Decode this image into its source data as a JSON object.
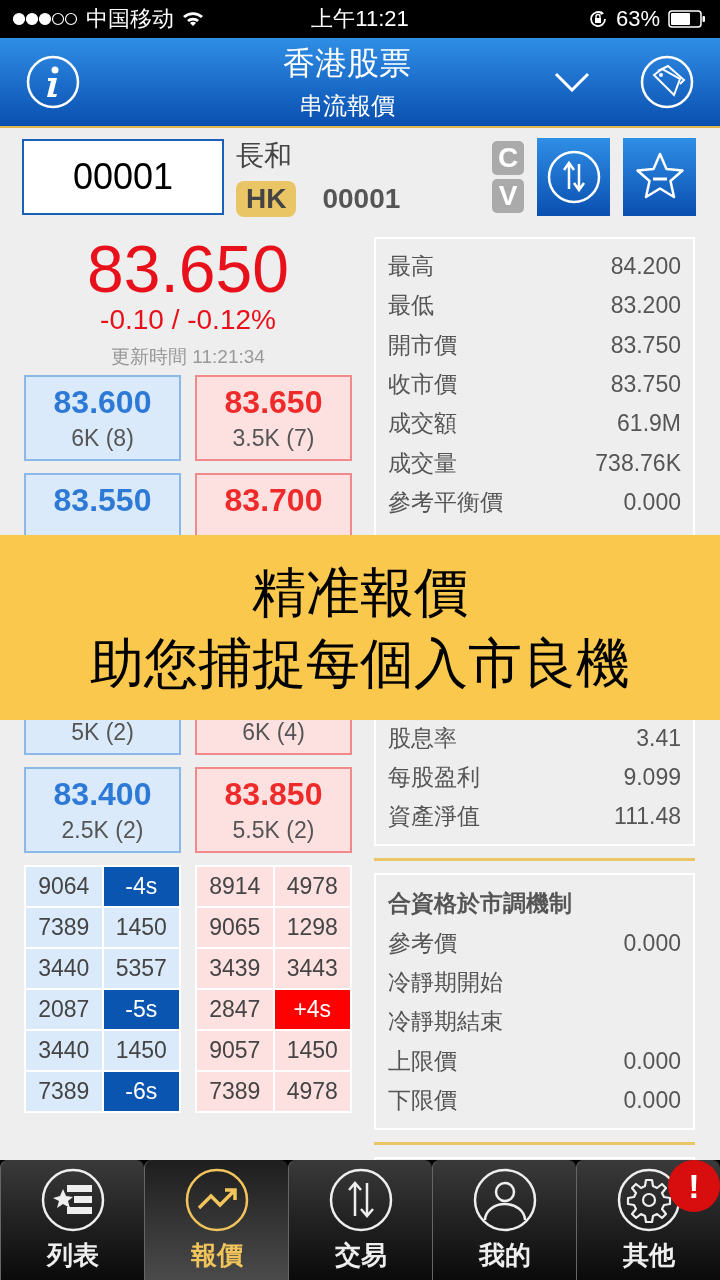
{
  "status_bar": {
    "carrier": "中国移动",
    "time": "上午11:21",
    "battery": "63%"
  },
  "header": {
    "title": "香港股票",
    "subtitle": "串流報價"
  },
  "stock": {
    "code_input": "00001",
    "name": "長和",
    "market": "HK",
    "code": "00001",
    "badges": [
      "C",
      "V"
    ]
  },
  "quote": {
    "price": "83.650",
    "change": "-0.10 / -0.12%",
    "updated": "更新時間 11:21:34"
  },
  "bids": [
    {
      "price": "83.600",
      "volume": "6K (8)"
    },
    {
      "price": "83.550"
    }
  ],
  "bids_below_banner": [
    {
      "volume": "5K (2)"
    },
    {
      "price": "83.400",
      "volume": "2.5K (2)"
    }
  ],
  "asks": [
    {
      "price": "83.650",
      "volume": "3.5K (7)"
    },
    {
      "price": "83.700"
    }
  ],
  "asks_below_banner": [
    {
      "volume": "6K (4)"
    },
    {
      "price": "83.850",
      "volume": "5.5K (2)"
    }
  ],
  "bid_ticks": [
    [
      {
        "text": "9064",
        "kind": "plain"
      },
      {
        "text": "-4s",
        "kind": "marker"
      }
    ],
    [
      {
        "text": "7389",
        "kind": "plain"
      },
      {
        "text": "1450",
        "kind": "plain"
      }
    ],
    [
      {
        "text": "3440",
        "kind": "plain"
      },
      {
        "text": "5357",
        "kind": "plain"
      }
    ],
    [
      {
        "text": "2087",
        "kind": "plain"
      },
      {
        "text": "-5s",
        "kind": "marker"
      }
    ],
    [
      {
        "text": "3440",
        "kind": "plain"
      },
      {
        "text": "1450",
        "kind": "plain"
      }
    ],
    [
      {
        "text": "7389",
        "kind": "plain"
      },
      {
        "text": "-6s",
        "kind": "marker"
      }
    ]
  ],
  "ask_ticks": [
    [
      {
        "text": "8914",
        "kind": "plain"
      },
      {
        "text": "4978",
        "kind": "plain"
      }
    ],
    [
      {
        "text": "9065",
        "kind": "plain"
      },
      {
        "text": "1298",
        "kind": "plain"
      }
    ],
    [
      {
        "text": "3439",
        "kind": "plain"
      },
      {
        "text": "3443",
        "kind": "plain"
      }
    ],
    [
      {
        "text": "2847",
        "kind": "plain"
      },
      {
        "text": "+4s",
        "kind": "marker"
      }
    ],
    [
      {
        "text": "9057",
        "kind": "plain"
      },
      {
        "text": "1450",
        "kind": "plain"
      }
    ],
    [
      {
        "text": "7389",
        "kind": "plain"
      },
      {
        "text": "4978",
        "kind": "plain"
      }
    ]
  ],
  "stats": [
    {
      "label": "最高",
      "value": "84.200"
    },
    {
      "label": "最低",
      "value": "83.200"
    },
    {
      "label": "開市價",
      "value": "83.750"
    },
    {
      "label": "收市價",
      "value": "83.750"
    },
    {
      "label": "成交額",
      "value": "61.9M"
    },
    {
      "label": "成交量",
      "value": "738.76K"
    },
    {
      "label": "參考平衡價",
      "value": "0.000"
    }
  ],
  "stats_below_banner": [
    {
      "label": "股息率",
      "value": "3.41"
    },
    {
      "label": "每股盈利",
      "value": "9.099"
    },
    {
      "label": "資產淨值",
      "value": "111.48"
    }
  ],
  "vcm": {
    "title": "合資格於市調機制",
    "rows": [
      {
        "label": "參考價",
        "value": "0.000"
      },
      {
        "label": "冷靜期開始"
      },
      {
        "label": "冷靜期結束"
      },
      {
        "label": "上限價",
        "value": "0.000"
      },
      {
        "label": "下限價",
        "value": "0.000"
      }
    ]
  },
  "banner": {
    "lines": [
      "精准報價",
      "助您捕捉每個入市良機"
    ]
  },
  "tabs": [
    {
      "label": "列表",
      "kind": "list",
      "selected": false
    },
    {
      "label": "報價",
      "kind": "chart",
      "selected": true
    },
    {
      "label": "交易",
      "kind": "transfer",
      "selected": false
    },
    {
      "label": "我的",
      "kind": "person",
      "selected": false
    },
    {
      "label": "其他",
      "kind": "gear",
      "selected": false,
      "badge": "!"
    }
  ]
}
